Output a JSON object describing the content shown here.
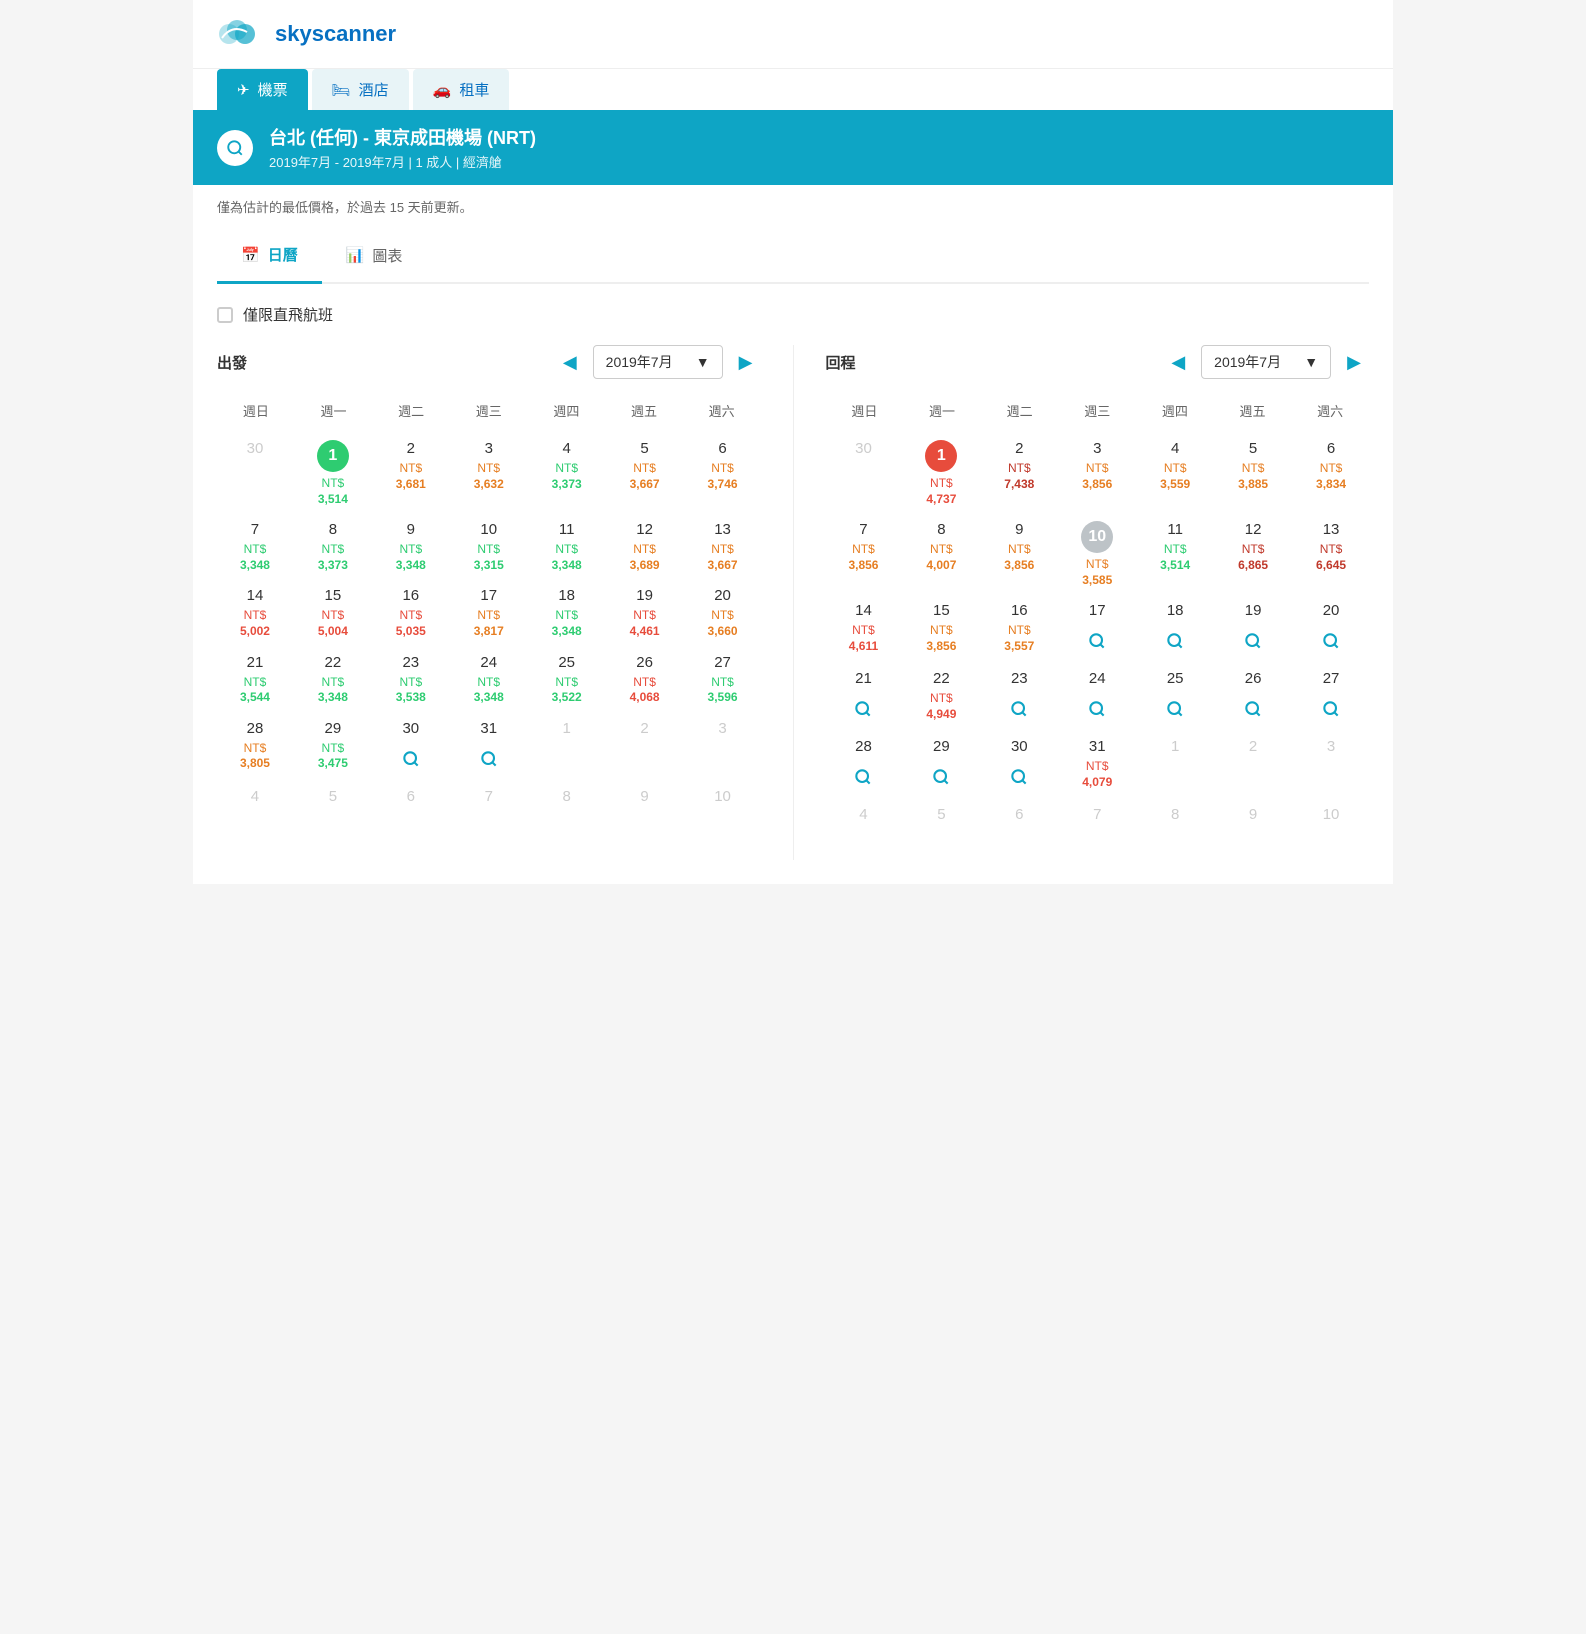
{
  "logo": {
    "text": "skyscanner"
  },
  "nav": {
    "tabs": [
      {
        "id": "flights",
        "label": "機票",
        "icon": "✈",
        "active": true
      },
      {
        "id": "hotels",
        "label": "酒店",
        "icon": "🛏",
        "active": false
      },
      {
        "id": "cars",
        "label": "租車",
        "icon": "🚗",
        "active": false
      }
    ]
  },
  "search": {
    "title": "台北 (任何) - 東京成田機場 (NRT)",
    "subtitle": "2019年7月 - 2019年7月  |  1 成人  |  經濟艙"
  },
  "disclaimer": "僅為估計的最低價格，於過去 15 天前更新。",
  "view_tabs": [
    {
      "id": "calendar",
      "label": "日曆",
      "icon": "📅",
      "active": true
    },
    {
      "id": "chart",
      "label": "圖表",
      "icon": "📊",
      "active": false
    }
  ],
  "filter": {
    "direct_only": "僅限直飛航班"
  },
  "departure": {
    "label": "出發",
    "month": "2019年7月",
    "weekdays": [
      "週日",
      "週一",
      "週二",
      "週三",
      "週四",
      "週五",
      "週六"
    ],
    "weeks": [
      [
        {
          "day": 30,
          "other": true
        },
        {
          "day": 1,
          "circle": "green",
          "price_color": "green",
          "currency": "NT$",
          "amount": "3,514"
        },
        {
          "day": 2,
          "price_color": "orange",
          "currency": "NT$",
          "amount": "3,681"
        },
        {
          "day": 3,
          "price_color": "orange",
          "currency": "NT$",
          "amount": "3,632"
        },
        {
          "day": 4,
          "price_color": "green",
          "currency": "NT$",
          "amount": "3,373"
        },
        {
          "day": 5,
          "price_color": "orange",
          "currency": "NT$",
          "amount": "3,667"
        },
        {
          "day": 6,
          "price_color": "orange",
          "currency": "NT$",
          "amount": "3,746"
        }
      ],
      [
        {
          "day": 7,
          "price_color": "green",
          "currency": "NT$",
          "amount": "3,348"
        },
        {
          "day": 8,
          "price_color": "green",
          "currency": "NT$",
          "amount": "3,373"
        },
        {
          "day": 9,
          "price_color": "green",
          "currency": "NT$",
          "amount": "3,348"
        },
        {
          "day": 10,
          "price_color": "green",
          "currency": "NT$",
          "amount": "3,315"
        },
        {
          "day": 11,
          "price_color": "green",
          "currency": "NT$",
          "amount": "3,348"
        },
        {
          "day": 12,
          "price_color": "orange",
          "currency": "NT$",
          "amount": "3,689"
        },
        {
          "day": 13,
          "price_color": "orange",
          "currency": "NT$",
          "amount": "3,667"
        }
      ],
      [
        {
          "day": 14,
          "price_color": "red",
          "currency": "NT$",
          "amount": "5,002"
        },
        {
          "day": 15,
          "price_color": "red",
          "currency": "NT$",
          "amount": "5,004"
        },
        {
          "day": 16,
          "price_color": "red",
          "currency": "NT$",
          "amount": "5,035"
        },
        {
          "day": 17,
          "price_color": "orange",
          "currency": "NT$",
          "amount": "3,817"
        },
        {
          "day": 18,
          "price_color": "green",
          "currency": "NT$",
          "amount": "3,348"
        },
        {
          "day": 19,
          "price_color": "red",
          "currency": "NT$",
          "amount": "4,461"
        },
        {
          "day": 20,
          "price_color": "orange",
          "currency": "NT$",
          "amount": "3,660"
        }
      ],
      [
        {
          "day": 21,
          "price_color": "green",
          "currency": "NT$",
          "amount": "3,544"
        },
        {
          "day": 22,
          "price_color": "green",
          "currency": "NT$",
          "amount": "3,348"
        },
        {
          "day": 23,
          "price_color": "green",
          "currency": "NT$",
          "amount": "3,538"
        },
        {
          "day": 24,
          "price_color": "green",
          "currency": "NT$",
          "amount": "3,348"
        },
        {
          "day": 25,
          "price_color": "green",
          "currency": "NT$",
          "amount": "3,522"
        },
        {
          "day": 26,
          "price_color": "red",
          "currency": "NT$",
          "amount": "4,068"
        },
        {
          "day": 27,
          "price_color": "green",
          "currency": "NT$",
          "amount": "3,596"
        }
      ],
      [
        {
          "day": 28,
          "price_color": "orange",
          "currency": "NT$",
          "amount": "3,805"
        },
        {
          "day": 29,
          "price_color": "green",
          "currency": "NT$",
          "amount": "3,475"
        },
        {
          "day": 30,
          "search": true
        },
        {
          "day": 31,
          "search": true
        },
        {
          "day": 1,
          "other": true
        },
        {
          "day": 2,
          "other": true
        },
        {
          "day": 3,
          "other": true
        }
      ],
      [
        {
          "day": 4,
          "other": true
        },
        {
          "day": 5,
          "other": true
        },
        {
          "day": 6,
          "other": true
        },
        {
          "day": 7,
          "other": true
        },
        {
          "day": 8,
          "other": true
        },
        {
          "day": 9,
          "other": true
        },
        {
          "day": 10,
          "other": true
        }
      ]
    ]
  },
  "return": {
    "label": "回程",
    "month": "2019年7月",
    "weekdays": [
      "週日",
      "週一",
      "週二",
      "週三",
      "週四",
      "週五",
      "週六"
    ],
    "weeks": [
      [
        {
          "day": 30,
          "other": true
        },
        {
          "day": 1,
          "circle": "red",
          "price_color": "red",
          "currency": "NT$",
          "amount": "4,737"
        },
        {
          "day": 2,
          "price_color": "dark-red",
          "currency": "NT$",
          "amount": "7,438"
        },
        {
          "day": 3,
          "price_color": "orange",
          "currency": "NT$",
          "amount": "3,856"
        },
        {
          "day": 4,
          "price_color": "orange",
          "currency": "NT$",
          "amount": "3,559"
        },
        {
          "day": 5,
          "price_color": "orange",
          "currency": "NT$",
          "amount": "3,885"
        },
        {
          "day": 6,
          "price_color": "orange",
          "currency": "NT$",
          "amount": "3,834"
        }
      ],
      [
        {
          "day": 7,
          "price_color": "orange",
          "currency": "NT$",
          "amount": "3,856"
        },
        {
          "day": 8,
          "price_color": "orange",
          "currency": "NT$",
          "amount": "4,007"
        },
        {
          "day": 9,
          "price_color": "orange",
          "currency": "NT$",
          "amount": "3,856"
        },
        {
          "day": 10,
          "circle": "gray",
          "price_color": "orange",
          "currency": "NT$",
          "amount": "3,585"
        },
        {
          "day": 11,
          "price_color": "green",
          "currency": "NT$",
          "amount": "3,514"
        },
        {
          "day": 12,
          "price_color": "dark-red",
          "currency": "NT$",
          "amount": "6,865"
        },
        {
          "day": 13,
          "price_color": "dark-red",
          "currency": "NT$",
          "amount": "6,645"
        }
      ],
      [
        {
          "day": 14,
          "price_color": "red",
          "currency": "NT$",
          "amount": "4,611"
        },
        {
          "day": 15,
          "price_color": "orange",
          "currency": "NT$",
          "amount": "3,856"
        },
        {
          "day": 16,
          "price_color": "orange",
          "currency": "NT$",
          "amount": "3,557"
        },
        {
          "day": 17,
          "search": true
        },
        {
          "day": 18,
          "search": true
        },
        {
          "day": 19,
          "search": true
        },
        {
          "day": 20,
          "search": true
        }
      ],
      [
        {
          "day": 21,
          "search": true
        },
        {
          "day": 22,
          "price_color": "red",
          "currency": "NT$",
          "amount": "4,949"
        },
        {
          "day": 23,
          "search": true
        },
        {
          "day": 24,
          "search": true
        },
        {
          "day": 25,
          "search": true
        },
        {
          "day": 26,
          "search": true
        },
        {
          "day": 27,
          "search": true
        }
      ],
      [
        {
          "day": 28,
          "search": true
        },
        {
          "day": 29,
          "search": true
        },
        {
          "day": 30,
          "search": true
        },
        {
          "day": 31,
          "price_color": "red",
          "currency": "NT$",
          "amount": "4,079"
        },
        {
          "day": 1,
          "other": true
        },
        {
          "day": 2,
          "other": true
        },
        {
          "day": 3,
          "other": true
        }
      ],
      [
        {
          "day": 4,
          "other": true
        },
        {
          "day": 5,
          "other": true
        },
        {
          "day": 6,
          "other": true
        },
        {
          "day": 7,
          "other": true
        },
        {
          "day": 8,
          "other": true
        },
        {
          "day": 9,
          "other": true
        },
        {
          "day": 10,
          "other": true
        }
      ]
    ]
  }
}
